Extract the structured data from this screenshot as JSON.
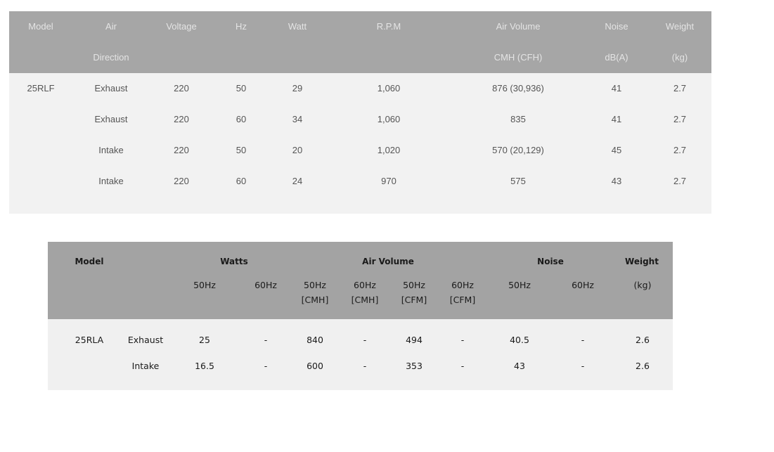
{
  "table1": {
    "header_row1": [
      "Model",
      "Air",
      "Voltage",
      "Hz",
      "Watt",
      "R.P.M",
      "Air Volume",
      "Noise",
      "Weight"
    ],
    "header_row2": [
      "",
      "Direction",
      "",
      "",
      "",
      "",
      "CMH (CFH)",
      "dB(A)",
      "(kg)"
    ],
    "rows": [
      [
        "25RLF",
        "Exhaust",
        "220",
        "50",
        "29",
        "1,060",
        "876 (30,936)",
        "41",
        "2.7"
      ],
      [
        "",
        "Exhaust",
        "220",
        "60",
        "34",
        "1,060",
        "835",
        "41",
        "2.7"
      ],
      [
        "",
        "Intake",
        "220",
        "50",
        "20",
        "1,020",
        "570 (20,129)",
        "45",
        "2.7"
      ],
      [
        "",
        "Intake",
        "220",
        "60",
        "24",
        "970",
        "575",
        "43",
        "2.7"
      ]
    ]
  },
  "table2": {
    "groups": [
      "Model",
      "Watts",
      "Air Volume",
      "Noise",
      "Weight"
    ],
    "subheaders": [
      "50Hz",
      "60Hz",
      "50Hz\n[CMH]",
      "60Hz\n[CMH]",
      "50Hz\n[CFM]",
      "60Hz\n[CFM]",
      "50Hz",
      "60Hz",
      "(kg)"
    ],
    "rows": [
      [
        "25RLA",
        "Exhaust",
        "25",
        "-",
        "840",
        "-",
        "494",
        "-",
        "40.5",
        "-",
        "2.6"
      ],
      [
        "",
        "Intake",
        "16.5",
        "-",
        "600",
        "-",
        "353",
        "-",
        "43",
        "-",
        "2.6"
      ]
    ]
  }
}
